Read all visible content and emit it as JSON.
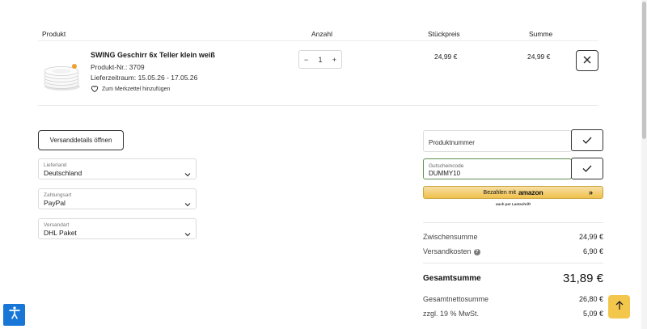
{
  "cart_header": {
    "product": "Produkt",
    "quantity": "Anzahl",
    "unit_price": "Stückpreis",
    "sum": "Summe"
  },
  "item": {
    "name": "SWING Geschirr 6x Teller klein weiß",
    "product_no": "Produkt-Nr.: 3709",
    "delivery": "Lieferzeitraum: 15.05.26 - 17.05.26",
    "wishlist": "Zum Merkzettel hinzufügen",
    "qty_minus": "−",
    "qty_value": "1",
    "qty_plus": "+",
    "unit_price": "24,99 €",
    "total": "24,99 €"
  },
  "shipping_button": "Versanddetails öffnen",
  "selects": {
    "country": {
      "label": "Lieferland",
      "value": "Deutschland"
    },
    "payment": {
      "label": "Zahlungsart",
      "value": "PayPal"
    },
    "shipping": {
      "label": "Versandart",
      "value": "DHL Paket"
    }
  },
  "product_number_field": {
    "placeholder": "Produktnummer"
  },
  "voucher_field": {
    "label": "Gutscheincode",
    "value": "DUMMY10"
  },
  "amazon_pay": {
    "label": "Bezahlen mit",
    "brand": "amazon",
    "arrow": "»",
    "sub": "auch per Lastschrift"
  },
  "summary": {
    "subtotal_label": "Zwischensumme",
    "subtotal_value": "24,99 €",
    "shipping_label": "Versandkosten",
    "shipping_value": "6,90 €",
    "total_label": "Gesamtsumme",
    "total_value": "31,89 €",
    "net_label": "Gesamtnettosumme",
    "net_value": "26,80 €",
    "vat_label": "zzgl. 19 % MwSt.",
    "vat_value": "5,09 €"
  },
  "colors": {
    "accent_yellow": "#f3c64c",
    "a11y_blue": "#1877d6",
    "focus_green": "#5e8f4f"
  },
  "icons": {
    "wishlist": "heart-icon",
    "remove": "close-icon",
    "select": "chevron-down-icon",
    "confirm": "checkmark-icon",
    "accessibility": "accessibility-icon",
    "scroll_top": "arrow-up-icon"
  }
}
